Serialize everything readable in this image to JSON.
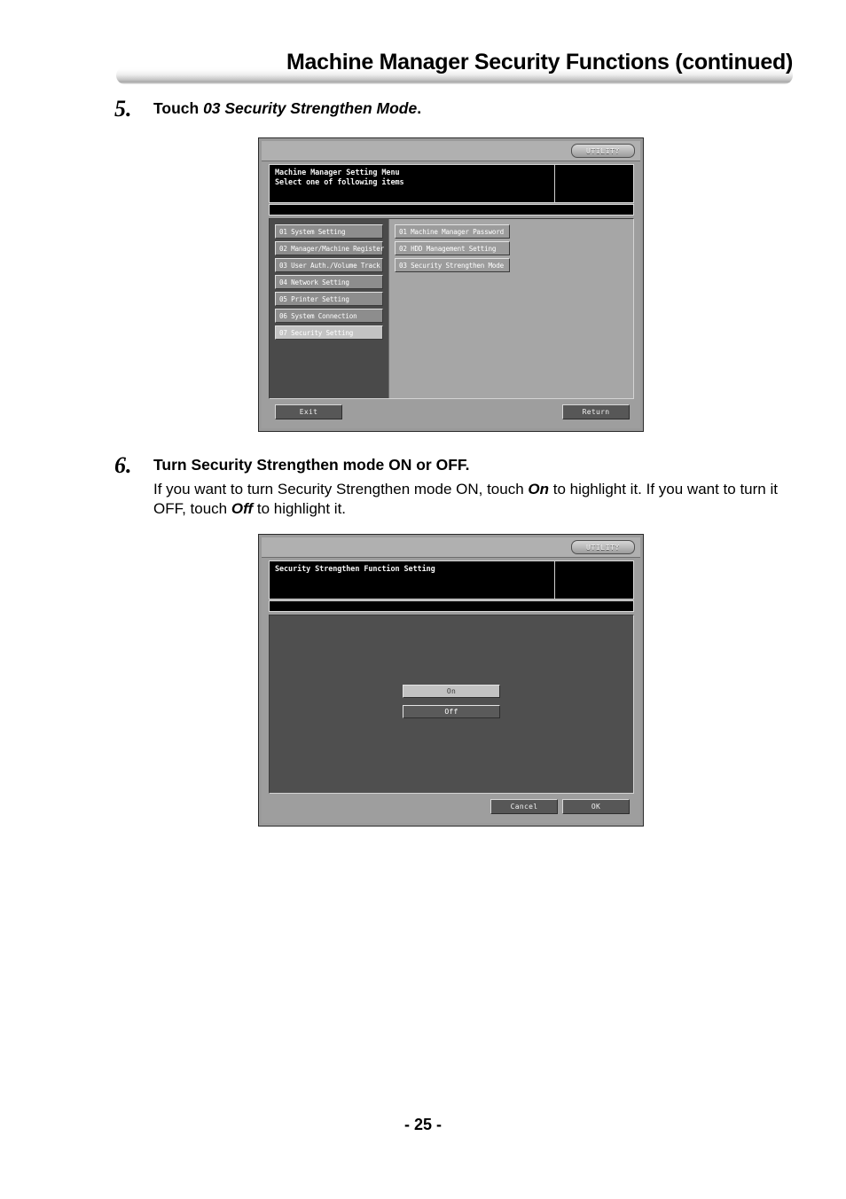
{
  "header": {
    "title": "Machine Manager Security Functions (continued)"
  },
  "steps": [
    {
      "number": "5.",
      "title_prefix": "Touch ",
      "title_italic": "03 Security Strengthen Mode",
      "title_suffix": ".",
      "description": ""
    },
    {
      "number": "6.",
      "title": "Turn Security Strengthen mode ON or OFF.",
      "desc_part1": "If you want to turn Security Strengthen mode ON, touch ",
      "desc_em1": "On",
      "desc_part2": " to highlight it. If you want to turn it OFF, touch ",
      "desc_em2": "Off",
      "desc_part3": " to highlight it."
    }
  ],
  "panel1": {
    "tab_label": "UTILITY",
    "message_line1": "Machine Manager Setting Menu",
    "message_line2": "Select one of following items",
    "left_menu": [
      {
        "label": "01 System Setting",
        "selected": false
      },
      {
        "label": "02 Manager/Machine Register",
        "selected": false
      },
      {
        "label": "03 User Auth./Volume Track",
        "selected": false
      },
      {
        "label": "04 Network Setting",
        "selected": false
      },
      {
        "label": "05 Printer Setting",
        "selected": false
      },
      {
        "label": "06 System Connection",
        "selected": false
      },
      {
        "label": "07 Security Setting",
        "selected": true
      }
    ],
    "right_menu": [
      {
        "label": "01 Machine Manager Password"
      },
      {
        "label": "02 HDD Management Setting"
      },
      {
        "label": "03 Security Strengthen Mode"
      }
    ],
    "exit_label": "Exit",
    "return_label": "Return"
  },
  "panel2": {
    "tab_label": "UTILITY",
    "message_line1": "Security Strengthen Function Setting",
    "toggles": [
      {
        "label": "On",
        "selected": true
      },
      {
        "label": "Off",
        "selected": false
      }
    ],
    "cancel_label": "Cancel",
    "ok_label": "OK"
  },
  "footer": {
    "page_number": "- 25 -"
  },
  "colors": {
    "lcd_frame": "#9a9a9a",
    "lcd_dark_panel": "#4a4a4a",
    "lcd_light_panel": "#a6a6a6",
    "lcd_black_display": "#000000",
    "button_face": "#575757",
    "selected_button": "#c3c3c3"
  }
}
